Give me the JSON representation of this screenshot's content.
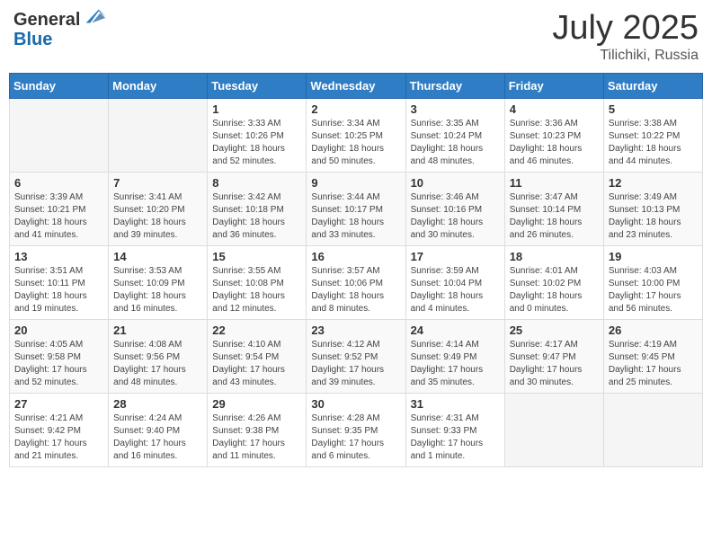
{
  "header": {
    "logo_general": "General",
    "logo_blue": "Blue",
    "month": "July 2025",
    "location": "Tilichiki, Russia"
  },
  "days_of_week": [
    "Sunday",
    "Monday",
    "Tuesday",
    "Wednesday",
    "Thursday",
    "Friday",
    "Saturday"
  ],
  "weeks": [
    [
      {
        "day": "",
        "info": ""
      },
      {
        "day": "",
        "info": ""
      },
      {
        "day": "1",
        "info": "Sunrise: 3:33 AM\nSunset: 10:26 PM\nDaylight: 18 hours\nand 52 minutes."
      },
      {
        "day": "2",
        "info": "Sunrise: 3:34 AM\nSunset: 10:25 PM\nDaylight: 18 hours\nand 50 minutes."
      },
      {
        "day": "3",
        "info": "Sunrise: 3:35 AM\nSunset: 10:24 PM\nDaylight: 18 hours\nand 48 minutes."
      },
      {
        "day": "4",
        "info": "Sunrise: 3:36 AM\nSunset: 10:23 PM\nDaylight: 18 hours\nand 46 minutes."
      },
      {
        "day": "5",
        "info": "Sunrise: 3:38 AM\nSunset: 10:22 PM\nDaylight: 18 hours\nand 44 minutes."
      }
    ],
    [
      {
        "day": "6",
        "info": "Sunrise: 3:39 AM\nSunset: 10:21 PM\nDaylight: 18 hours\nand 41 minutes."
      },
      {
        "day": "7",
        "info": "Sunrise: 3:41 AM\nSunset: 10:20 PM\nDaylight: 18 hours\nand 39 minutes."
      },
      {
        "day": "8",
        "info": "Sunrise: 3:42 AM\nSunset: 10:18 PM\nDaylight: 18 hours\nand 36 minutes."
      },
      {
        "day": "9",
        "info": "Sunrise: 3:44 AM\nSunset: 10:17 PM\nDaylight: 18 hours\nand 33 minutes."
      },
      {
        "day": "10",
        "info": "Sunrise: 3:46 AM\nSunset: 10:16 PM\nDaylight: 18 hours\nand 30 minutes."
      },
      {
        "day": "11",
        "info": "Sunrise: 3:47 AM\nSunset: 10:14 PM\nDaylight: 18 hours\nand 26 minutes."
      },
      {
        "day": "12",
        "info": "Sunrise: 3:49 AM\nSunset: 10:13 PM\nDaylight: 18 hours\nand 23 minutes."
      }
    ],
    [
      {
        "day": "13",
        "info": "Sunrise: 3:51 AM\nSunset: 10:11 PM\nDaylight: 18 hours\nand 19 minutes."
      },
      {
        "day": "14",
        "info": "Sunrise: 3:53 AM\nSunset: 10:09 PM\nDaylight: 18 hours\nand 16 minutes."
      },
      {
        "day": "15",
        "info": "Sunrise: 3:55 AM\nSunset: 10:08 PM\nDaylight: 18 hours\nand 12 minutes."
      },
      {
        "day": "16",
        "info": "Sunrise: 3:57 AM\nSunset: 10:06 PM\nDaylight: 18 hours\nand 8 minutes."
      },
      {
        "day": "17",
        "info": "Sunrise: 3:59 AM\nSunset: 10:04 PM\nDaylight: 18 hours\nand 4 minutes."
      },
      {
        "day": "18",
        "info": "Sunrise: 4:01 AM\nSunset: 10:02 PM\nDaylight: 18 hours\nand 0 minutes."
      },
      {
        "day": "19",
        "info": "Sunrise: 4:03 AM\nSunset: 10:00 PM\nDaylight: 17 hours\nand 56 minutes."
      }
    ],
    [
      {
        "day": "20",
        "info": "Sunrise: 4:05 AM\nSunset: 9:58 PM\nDaylight: 17 hours\nand 52 minutes."
      },
      {
        "day": "21",
        "info": "Sunrise: 4:08 AM\nSunset: 9:56 PM\nDaylight: 17 hours\nand 48 minutes."
      },
      {
        "day": "22",
        "info": "Sunrise: 4:10 AM\nSunset: 9:54 PM\nDaylight: 17 hours\nand 43 minutes."
      },
      {
        "day": "23",
        "info": "Sunrise: 4:12 AM\nSunset: 9:52 PM\nDaylight: 17 hours\nand 39 minutes."
      },
      {
        "day": "24",
        "info": "Sunrise: 4:14 AM\nSunset: 9:49 PM\nDaylight: 17 hours\nand 35 minutes."
      },
      {
        "day": "25",
        "info": "Sunrise: 4:17 AM\nSunset: 9:47 PM\nDaylight: 17 hours\nand 30 minutes."
      },
      {
        "day": "26",
        "info": "Sunrise: 4:19 AM\nSunset: 9:45 PM\nDaylight: 17 hours\nand 25 minutes."
      }
    ],
    [
      {
        "day": "27",
        "info": "Sunrise: 4:21 AM\nSunset: 9:42 PM\nDaylight: 17 hours\nand 21 minutes."
      },
      {
        "day": "28",
        "info": "Sunrise: 4:24 AM\nSunset: 9:40 PM\nDaylight: 17 hours\nand 16 minutes."
      },
      {
        "day": "29",
        "info": "Sunrise: 4:26 AM\nSunset: 9:38 PM\nDaylight: 17 hours\nand 11 minutes."
      },
      {
        "day": "30",
        "info": "Sunrise: 4:28 AM\nSunset: 9:35 PM\nDaylight: 17 hours\nand 6 minutes."
      },
      {
        "day": "31",
        "info": "Sunrise: 4:31 AM\nSunset: 9:33 PM\nDaylight: 17 hours\nand 1 minute."
      },
      {
        "day": "",
        "info": ""
      },
      {
        "day": "",
        "info": ""
      }
    ]
  ]
}
